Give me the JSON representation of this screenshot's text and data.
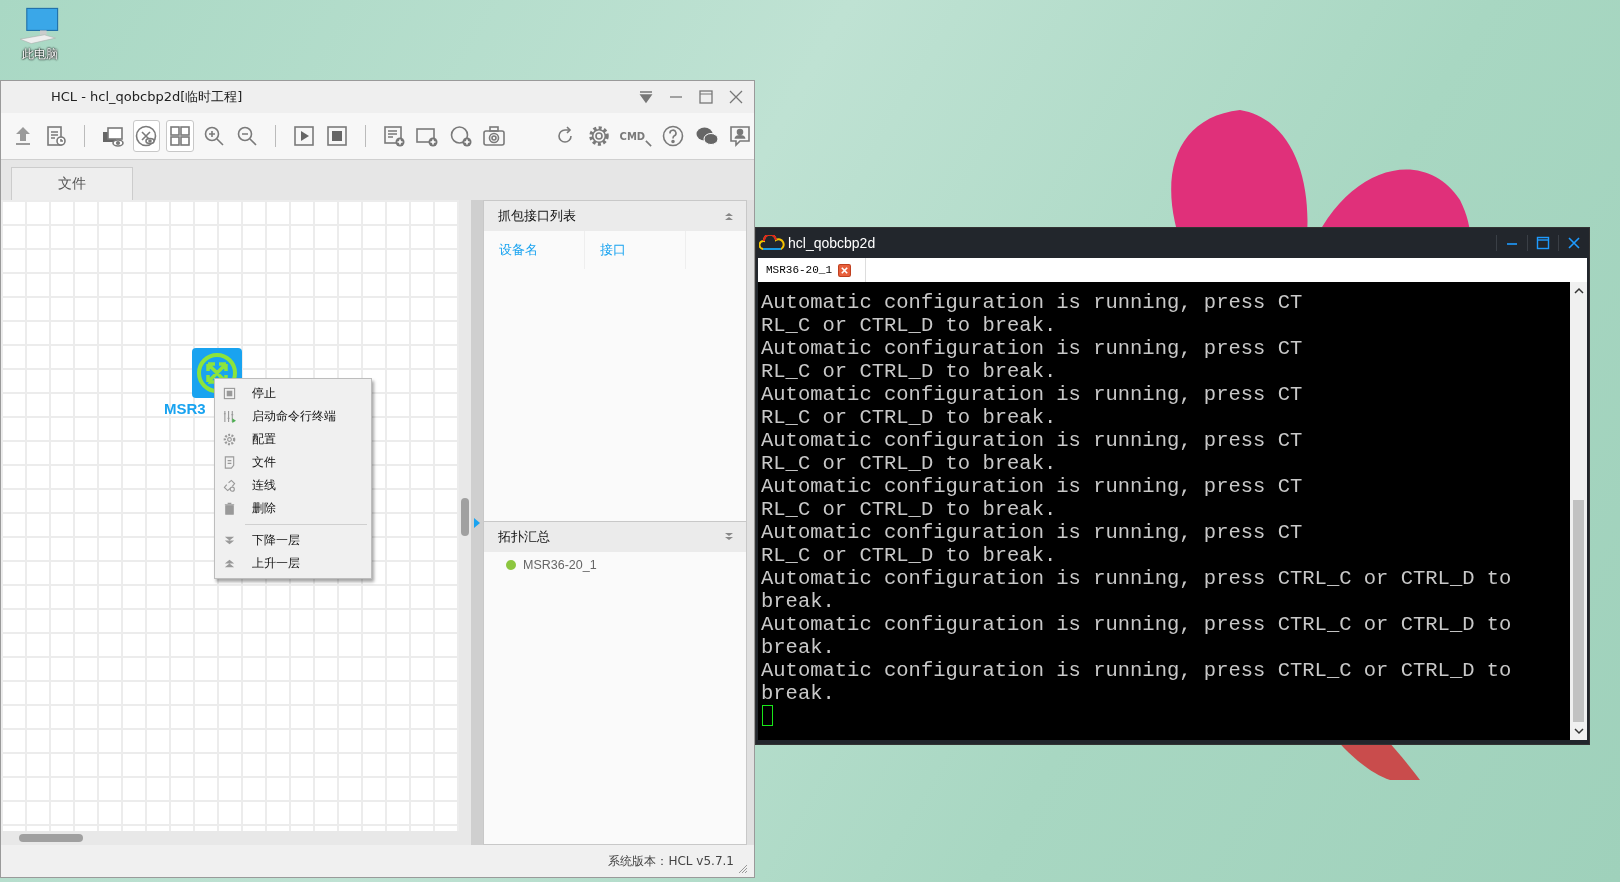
{
  "desktop": {
    "icons": [
      {
        "label": "此电脑"
      }
    ]
  },
  "hcl_window": {
    "title": "HCL - hcl_qobcbp2d[临时工程]",
    "toolbar": [
      [
        {
          "kind": "upload",
          "selected": false
        },
        {
          "kind": "log",
          "selected": false
        }
      ],
      [
        {
          "kind": "capture",
          "selected": false
        },
        {
          "kind": "topology",
          "selected": true
        },
        {
          "kind": "grid",
          "selected": true
        },
        {
          "kind": "zoom-in",
          "selected": false
        },
        {
          "kind": "zoom-out",
          "selected": false
        }
      ],
      [
        {
          "kind": "start",
          "selected": false
        },
        {
          "kind": "stop",
          "selected": false
        }
      ],
      [
        {
          "kind": "list-add",
          "selected": false
        },
        {
          "kind": "rect-add",
          "selected": false
        },
        {
          "kind": "circle-add",
          "selected": false
        },
        {
          "kind": "camera",
          "selected": false
        }
      ],
      [
        {
          "kind": "refresh",
          "selected": false
        },
        {
          "kind": "settings",
          "selected": false
        },
        {
          "kind": "cmd",
          "text": "CMD",
          "selected": false
        },
        {
          "kind": "help",
          "selected": false
        },
        {
          "kind": "chat",
          "selected": false
        },
        {
          "kind": "feedback",
          "selected": false
        }
      ]
    ],
    "tabs": [
      {
        "label": "文件",
        "selected": true
      }
    ],
    "device": {
      "label": "MSR3"
    },
    "context_menu": [
      [
        {
          "kind": "stop",
          "label": "停止"
        },
        {
          "kind": "terminal",
          "label": "启动命令行终端"
        },
        {
          "kind": "settings",
          "label": "配置"
        },
        {
          "kind": "file",
          "label": "文件"
        },
        {
          "kind": "link",
          "label": "连线"
        },
        {
          "kind": "delete",
          "label": "删除"
        }
      ],
      [
        {
          "kind": "down",
          "label": "下降一层"
        },
        {
          "kind": "up",
          "label": "上升一层"
        }
      ]
    ],
    "capture_panel": {
      "title": "抓包接口列表",
      "columns": [
        "设备名",
        "接口"
      ]
    },
    "topology_panel": {
      "title": "拓扑汇总",
      "items": [
        {
          "name": "MSR36-20_1",
          "color": "#8cc63f"
        }
      ]
    },
    "status_bar": "系统版本：HCL v5.7.1"
  },
  "terminal_window": {
    "title": "hcl_qobcbp2d",
    "tabs": [
      {
        "label": "MSR36-20_1",
        "selected": true
      }
    ],
    "lines": [
      "Automatic configuration is running, press CT",
      "RL_C or CTRL_D to break.",
      "Automatic configuration is running, press CT",
      "RL_C or CTRL_D to break.",
      "Automatic configuration is running, press CT",
      "RL_C or CTRL_D to break.",
      "Automatic configuration is running, press CT",
      "RL_C or CTRL_D to break.",
      "Automatic configuration is running, press CT",
      "RL_C or CTRL_D to break.",
      "Automatic configuration is running, press CT",
      "RL_C or CTRL_D to break.",
      "Automatic configuration is running, press CTRL_C or CTRL_D to",
      "break.",
      "Automatic configuration is running, press CTRL_C or CTRL_D to",
      "break.",
      "Automatic configuration is running, press CTRL_C or CTRL_D to",
      "break."
    ]
  }
}
